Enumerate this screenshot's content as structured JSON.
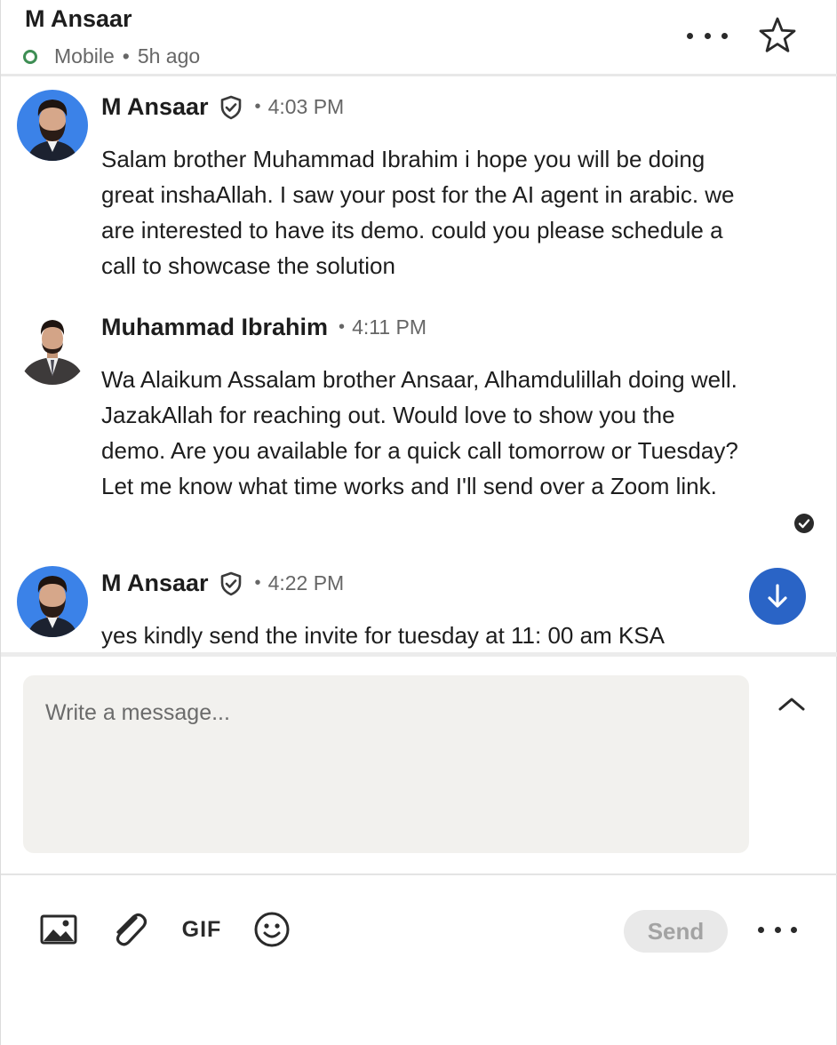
{
  "header": {
    "contact_name": "M Ansaar",
    "status_device": "Mobile",
    "status_sep": "•",
    "status_time": "5h ago",
    "more_icon": "more-horizontal-icon",
    "star_icon": "star-outline-icon"
  },
  "messages": [
    {
      "sender": "M Ansaar",
      "verified": true,
      "sep": "•",
      "time": "4:03 PM",
      "text": "Salam brother Muhammad Ibrahim i hope you will be doing great inshaAllah. I saw your post for the AI agent in arabic. we are interested to have its demo. could you please schedule a call to showcase the solution"
    },
    {
      "sender": "Muhammad Ibrahim",
      "verified": false,
      "sep": "•",
      "time": "4:11 PM",
      "text": "Wa Alaikum Assalam brother Ansaar, Alhamdulillah doing well. JazakAllah for reaching out. Would love to show you the demo. Are you available for a quick call tomorrow or Tuesday? Let me know what time works and I'll send over a Zoom link.",
      "read_receipt_icon": "read-check-icon"
    },
    {
      "sender": "M Ansaar",
      "verified": true,
      "sep": "•",
      "time": "4:22 PM",
      "text": "yes kindly send the invite for tuesday at 11: 00 am KSA"
    }
  ],
  "composer": {
    "placeholder": "Write a message...",
    "gif_label": "GIF",
    "send_label": "Send",
    "icons": [
      "image-icon",
      "attachment-icon",
      "gif-icon",
      "emoji-icon",
      "more-horizontal-icon",
      "chevron-up-icon",
      "arrow-down-icon"
    ]
  },
  "colors": {
    "accent_blue": "#2a64c6",
    "online_green": "#3e8e54",
    "composer_bg": "#f2f1ee",
    "muted_text": "#666666"
  }
}
